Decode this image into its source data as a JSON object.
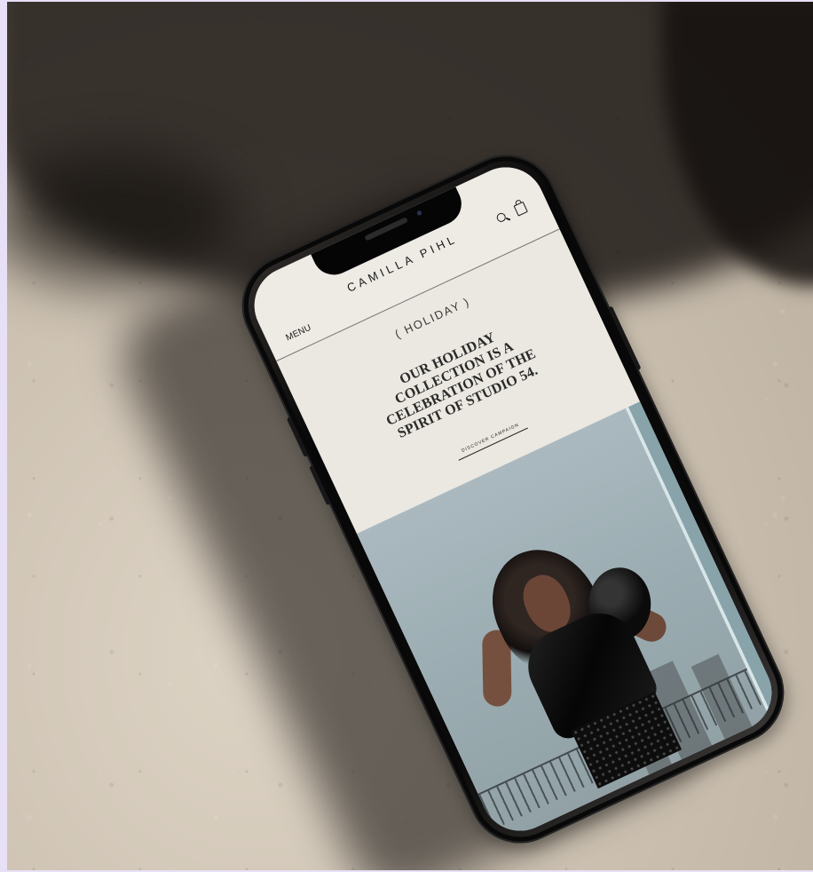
{
  "phone_screen": {
    "header": {
      "menu_label": "MENU",
      "brand_name": "CAMILLA PIHL",
      "search_icon": "search-icon",
      "bag_icon": "shopping-bag-icon"
    },
    "hero": {
      "label": "( HOLIDAY )",
      "headline": "OUR HOLIDAY COLLECTION IS A CELEBRATION OF THE SPIRIT OF STUDIO 54.",
      "cta": "DISCOVER CAMPAIGN"
    }
  },
  "colors": {
    "screen_background": "#ece9e2",
    "photo_background": "#9aacb1",
    "phone_frame": "#080808",
    "surface": "#d3c9bb"
  }
}
